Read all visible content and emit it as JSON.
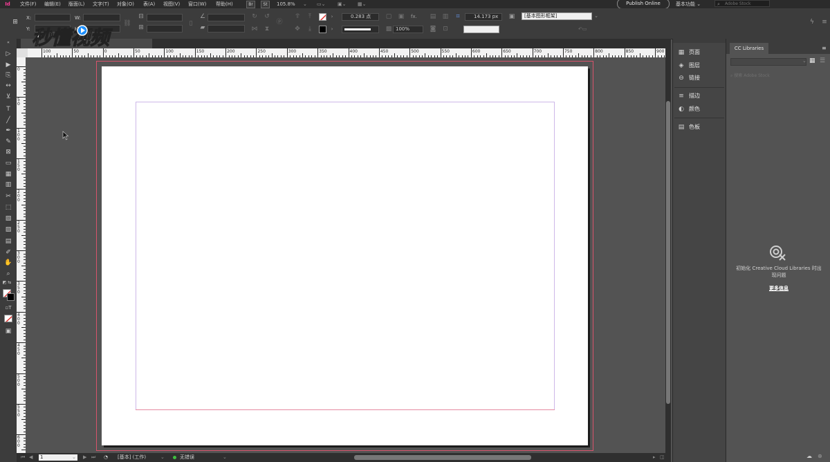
{
  "menubar": {
    "app_logo": "Id",
    "items": [
      "文件(F)",
      "编辑(E)",
      "版面(L)",
      "文字(T)",
      "对象(O)",
      "表(A)",
      "视图(V)",
      "窗口(W)",
      "帮助(H)"
    ],
    "bridge": "Br",
    "stock": "St",
    "zoom": "105.8%",
    "publish": "Publish Online",
    "workspace": "基本功能",
    "stock_search_placeholder": "Adobe Stock"
  },
  "control": {
    "x_label": "X:",
    "y_label": "Y:",
    "w_label": "W:",
    "h_label": "H:",
    "stroke_weight": "0.283 点",
    "dimension": "14.173 px",
    "opacity": "100%",
    "object_style": "[基本图形框架]",
    "fx_label": "fx."
  },
  "rulers": {
    "h_ticks": [
      "100",
      "50",
      "0",
      "50",
      "100",
      "150",
      "200",
      "250",
      "300",
      "350",
      "400",
      "450",
      "500",
      "550",
      "600",
      "650",
      "700",
      "750",
      "800",
      "850",
      "900"
    ],
    "v_ticks": [
      "0",
      "50",
      "100",
      "150",
      "200",
      "250",
      "300",
      "350",
      "400",
      "450",
      "500",
      "550",
      "600"
    ]
  },
  "panels": {
    "items": [
      {
        "icon": "pages-icon",
        "glyph": "▦",
        "label": "页面"
      },
      {
        "icon": "layers-icon",
        "glyph": "◈",
        "label": "图层"
      },
      {
        "icon": "links-icon",
        "glyph": "⊖",
        "label": "链接"
      },
      {
        "icon": "stroke-icon",
        "glyph": "≡",
        "label": "描边"
      },
      {
        "icon": "color-icon",
        "glyph": "◐",
        "label": "颜色"
      },
      {
        "icon": "swatches-icon",
        "glyph": "▤",
        "label": "色板"
      }
    ]
  },
  "cc": {
    "tab": "CC Libraries",
    "search_placeholder": "搜索 Adobe Stock",
    "message": "初始化 Creative Cloud Libraries 时出现问题",
    "more_info": "更多信息"
  },
  "status": {
    "page": "1",
    "style": "[基本] (工作)",
    "preflight": "无错误"
  },
  "watermark": {
    "text": "秒懂视频"
  },
  "colors": {
    "bleed": "#d9536c",
    "margin": "#cdb7e8",
    "preflight_ok": "#3fbf3f",
    "logo": "#ff3d9a"
  }
}
